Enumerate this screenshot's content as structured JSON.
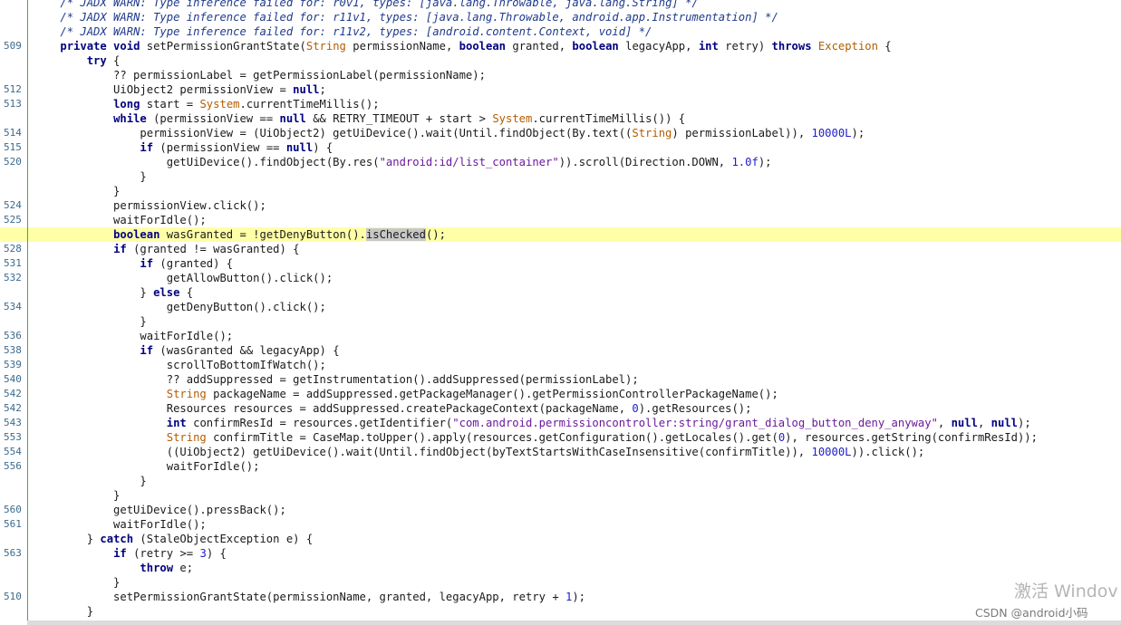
{
  "editor": {
    "lines": [
      {
        "ln": "",
        "html": "    <span class=\"cm\">/* JADX WARN: Type inference failed for: r0v1, types: [java.lang.Throwable, java.lang.String] */</span>"
      },
      {
        "ln": "",
        "html": "    <span class=\"cm\">/* JADX WARN: Type inference failed for: r11v1, types: [java.lang.Throwable, android.app.Instrumentation] */</span>"
      },
      {
        "ln": "",
        "html": "    <span class=\"cm\">/* JADX WARN: Type inference failed for: r11v2, types: [android.content.Context, void] */</span>"
      },
      {
        "ln": "509",
        "html": "    <span class=\"kw\">private void</span> setPermissionGrantState(<span class=\"ty\">String</span> permissionName, <span class=\"kw\">boolean</span> granted, <span class=\"kw\">boolean</span> legacyApp, <span class=\"kw\">int</span> retry) <span class=\"kw\">throws</span> <span class=\"ty\">Exception</span> {"
      },
      {
        "ln": "",
        "html": "        <span class=\"kw\">try</span> {"
      },
      {
        "ln": "",
        "html": "            ?? permissionLabel = getPermissionLabel(permissionName);"
      },
      {
        "ln": "512",
        "html": "            UiObject2 permissionView = <span class=\"kw\">null</span>;"
      },
      {
        "ln": "513",
        "html": "            <span class=\"kw\">long</span> start = <span class=\"ty\">System</span>.currentTimeMillis();"
      },
      {
        "ln": "",
        "html": "            <span class=\"kw\">while</span> (permissionView == <span class=\"kw\">null</span> &amp;&amp; RETRY_TIMEOUT + start &gt; <span class=\"ty\">System</span>.currentTimeMillis()) {"
      },
      {
        "ln": "514",
        "html": "                permissionView = (UiObject2) getUiDevice().wait(Until.findObject(By.text((<span class=\"ty\">String</span>) permissionLabel)), <span class=\"nm\">10000L</span>);"
      },
      {
        "ln": "515",
        "html": "                <span class=\"kw\">if</span> (permissionView == <span class=\"kw\">null</span>) {"
      },
      {
        "ln": "520",
        "html": "                    getUiDevice().findObject(By.res(<span class=\"st\">\"android:id/list_container\"</span>)).scroll(Direction.DOWN, <span class=\"nm\">1.0f</span>);"
      },
      {
        "ln": "",
        "html": "                }"
      },
      {
        "ln": "",
        "html": "            }"
      },
      {
        "ln": "524",
        "html": "            permissionView.click();"
      },
      {
        "ln": "525",
        "html": "            waitForIdle();"
      },
      {
        "ln": "",
        "html": "            <span class=\"kw\">boolean</span> wasGranted = !getDenyButton().<span class=\"sel\">isChecked</span>();",
        "highlight": true
      },
      {
        "ln": "528",
        "html": "            <span class=\"kw\">if</span> (granted != wasGranted) {"
      },
      {
        "ln": "531",
        "html": "                <span class=\"kw\">if</span> (granted) {"
      },
      {
        "ln": "532",
        "html": "                    getAllowButton().click();"
      },
      {
        "ln": "",
        "html": "                } <span class=\"kw\">else</span> {"
      },
      {
        "ln": "534",
        "html": "                    getDenyButton().click();"
      },
      {
        "ln": "",
        "html": "                }"
      },
      {
        "ln": "536",
        "html": "                waitForIdle();"
      },
      {
        "ln": "538",
        "html": "                <span class=\"kw\">if</span> (wasGranted &amp;&amp; legacyApp) {"
      },
      {
        "ln": "539",
        "html": "                    scrollToBottomIfWatch();"
      },
      {
        "ln": "540",
        "html": "                    ?? addSuppressed = getInstrumentation().addSuppressed(permissionLabel);"
      },
      {
        "ln": "542",
        "html": "                    <span class=\"ty\">String</span> packageName = addSuppressed.getPackageManager().getPermissionControllerPackageName();"
      },
      {
        "ln": "542",
        "html": "                    Resources resources = addSuppressed.createPackageContext(packageName, <span class=\"nm\">0</span>).getResources();"
      },
      {
        "ln": "543",
        "html": "                    <span class=\"kw\">int</span> confirmResId = resources.getIdentifier(<span class=\"st\">\"com.android.permissioncontroller:string/grant_dialog_button_deny_anyway\"</span>, <span class=\"kw\">null</span>, <span class=\"kw\">null</span>);"
      },
      {
        "ln": "553",
        "html": "                    <span class=\"ty\">String</span> confirmTitle = CaseMap.toUpper().apply(resources.getConfiguration().getLocales().get(<span class=\"nm\">0</span>), resources.getString(confirmResId));"
      },
      {
        "ln": "554",
        "html": "                    ((UiObject2) getUiDevice().wait(Until.findObject(byTextStartsWithCaseInsensitive(confirmTitle)), <span class=\"nm\">10000L</span>)).click();"
      },
      {
        "ln": "556",
        "html": "                    waitForIdle();"
      },
      {
        "ln": "",
        "html": "                }"
      },
      {
        "ln": "",
        "html": "            }"
      },
      {
        "ln": "560",
        "html": "            getUiDevice().pressBack();"
      },
      {
        "ln": "561",
        "html": "            waitForIdle();"
      },
      {
        "ln": "",
        "html": "        } <span class=\"kw\">catch</span> (StaleObjectException e) {"
      },
      {
        "ln": "563",
        "html": "            <span class=\"kw\">if</span> (retry &gt;= <span class=\"nm\">3</span>) {"
      },
      {
        "ln": "",
        "html": "                <span class=\"kw\">throw</span> e;"
      },
      {
        "ln": "",
        "html": "            }"
      },
      {
        "ln": "510",
        "html": "            setPermissionGrantState(permissionName, granted, legacyApp, retry + <span class=\"nm\">1</span>);"
      },
      {
        "ln": "",
        "html": "        }"
      }
    ]
  },
  "watermark": {
    "activate": "激活 Windov",
    "csdn": "CSDN @android小码"
  },
  "colors": {
    "highlight_line": "#ffffa8",
    "gutter_border": "#4fa04f",
    "keyword": "#000080",
    "type": "#b25d00",
    "string": "#6b1a9c",
    "number": "#1e1ec8"
  }
}
